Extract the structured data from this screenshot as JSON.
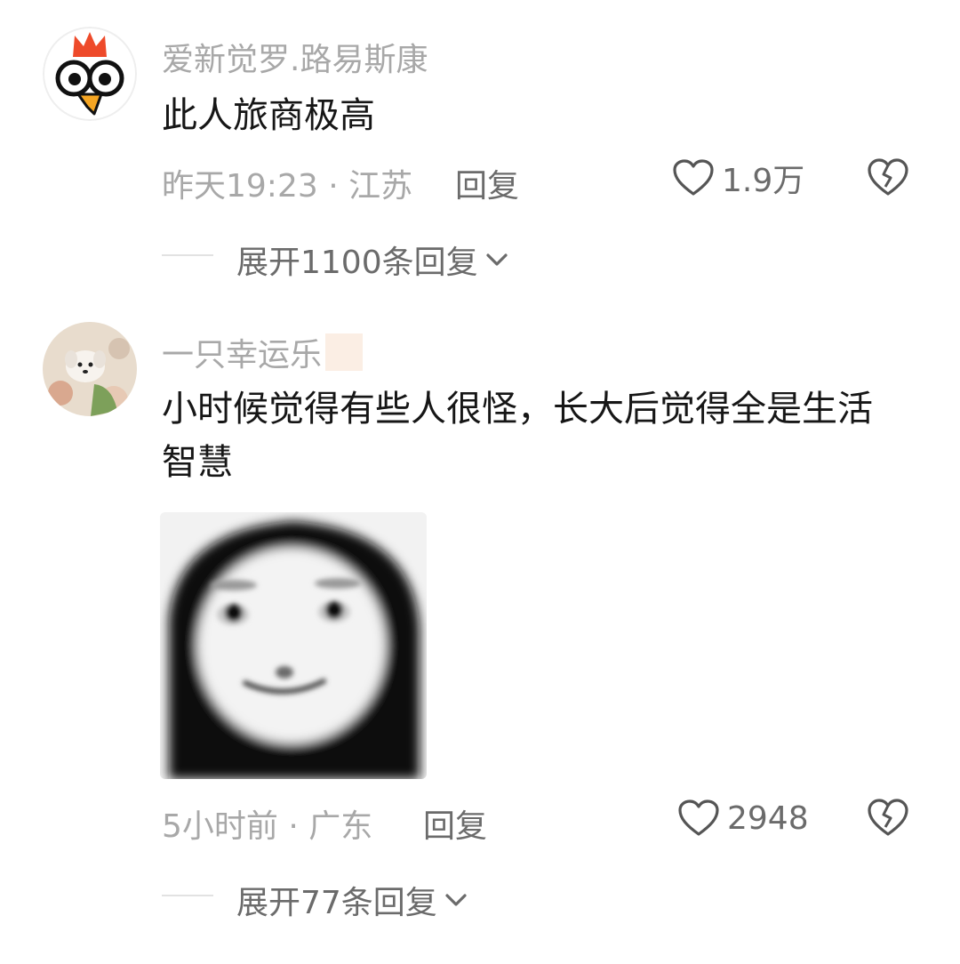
{
  "comments": [
    {
      "username": "爱新觉罗.路易斯康",
      "text": "此人旅商极高",
      "meta": "昨天19:23 · 江苏",
      "reply_label": "回复",
      "likes": "1.9万",
      "expand_label": "展开1100条回复",
      "avatar_icon": "chicken-cartoon-avatar"
    },
    {
      "username": "一只幸运乐",
      "text": "小时候觉得有些人很怪，长大后觉得全是生活智慧",
      "meta": "5小时前 · 广东",
      "reply_label": "回复",
      "likes": "2948",
      "expand_label": "展开77条回复",
      "avatar_icon": "puppy-photo-avatar",
      "attachment_icon": "meme-face-image"
    }
  ],
  "colors": {
    "primary_text": "#161616",
    "secondary_text": "#a8a8a8",
    "action_text": "#6b6b6b",
    "divider": "#e2e2e2"
  }
}
